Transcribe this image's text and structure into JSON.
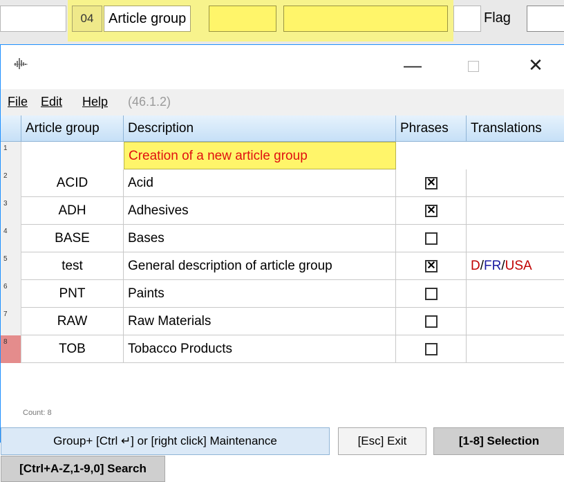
{
  "background_form": {
    "field_number": "04",
    "field_label": "Article group",
    "flag_label": "Flag"
  },
  "window": {
    "app_icon": "waveform-icon",
    "minimize_glyph": "—",
    "close_glyph": "✕"
  },
  "menu": {
    "file": "File",
    "edit": "Edit",
    "help": "Help",
    "version": "(46.1.2)"
  },
  "grid": {
    "columns": [
      "Article group",
      "Description",
      "Phrases",
      "Translations"
    ],
    "new_entry_label": "Creation of a new article group",
    "rows": [
      {
        "num": "1",
        "code": "",
        "description": "",
        "phrases": null,
        "translations": ""
      },
      {
        "num": "2",
        "code": "ACID",
        "description": "Acid",
        "phrases": true,
        "translations": ""
      },
      {
        "num": "3",
        "code": "ADH",
        "description": "Adhesives",
        "phrases": true,
        "translations": ""
      },
      {
        "num": "4",
        "code": "BASE",
        "description": "Bases",
        "phrases": false,
        "translations": ""
      },
      {
        "num": "5",
        "code": "test",
        "description": "General description of article group",
        "phrases": true,
        "translations": "D/FR/USA"
      },
      {
        "num": "6",
        "code": "PNT",
        "description": "Paints",
        "phrases": false,
        "translations": ""
      },
      {
        "num": "7",
        "code": "RAW",
        "description": "Raw Materials",
        "phrases": false,
        "translations": ""
      },
      {
        "num": "8",
        "code": "TOB",
        "description": "Tobacco Products",
        "phrases": false,
        "translations": ""
      }
    ],
    "selected_row": "8"
  },
  "footer": {
    "count": "Count: 8",
    "maintenance_button": "Group+ [Ctrl ↵] or [right click] Maintenance",
    "exit_button": "[Esc] Exit",
    "selection_button": "[1-8] Selection",
    "search_button": "[Ctrl+A-Z,1-9,0] Search"
  },
  "colors": {
    "highlight_yellow": "#fff56a",
    "header_blue": "#c6e0f7",
    "selected_row_marker": "#e48c8c",
    "new_entry_text": "#e01010"
  }
}
